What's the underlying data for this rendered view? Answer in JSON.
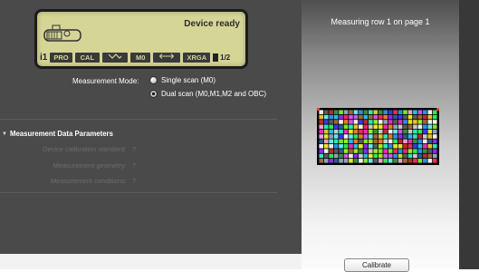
{
  "lcd": {
    "status": "Device ready",
    "logo": "i1",
    "chips": [
      "PRO",
      "CAL",
      "",
      "M0",
      "",
      "XRGA"
    ],
    "page": "1/2"
  },
  "measurement_mode": {
    "label": "Measurement Mode:",
    "options": [
      {
        "label": "Single scan (M0)",
        "selected": false
      },
      {
        "label": "Dual scan (M0,M1,M2 and OBC)",
        "selected": true
      }
    ]
  },
  "params": {
    "header": "Measurement Data Parameters",
    "rows": [
      {
        "label": "Device calibration standard:",
        "value": "?"
      },
      {
        "label": "Measurement geometry:",
        "value": "?"
      },
      {
        "label": "Measurement conditions:",
        "value": "?"
      }
    ]
  },
  "preview": {
    "title": "Measuring row 1 on page 1",
    "calibrate_label": "Calibrate",
    "chart_rows": 11,
    "chart_cols": 24
  },
  "colors": {
    "lcd_bg": "#d5d596",
    "panel_dark": "#4a4a4a"
  }
}
